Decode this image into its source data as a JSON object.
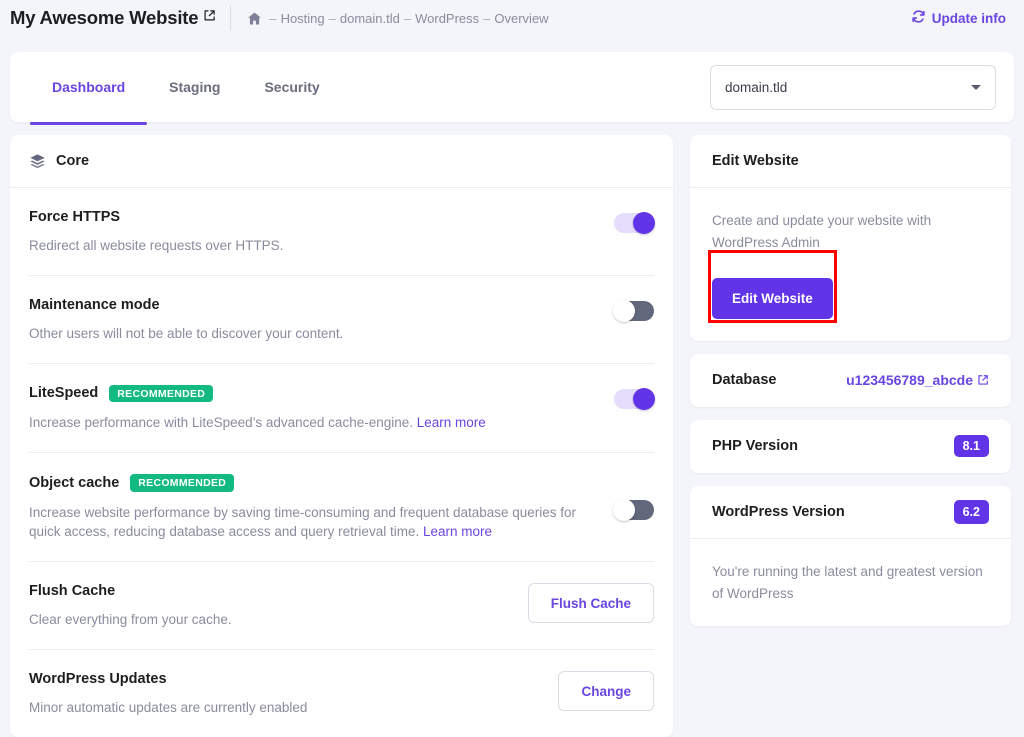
{
  "header": {
    "site_title": "My Awesome Website",
    "external_link_icon": "external-link-icon",
    "home_icon": "home-icon",
    "breadcrumb": [
      {
        "sep": "–",
        "label": "Hosting"
      },
      {
        "sep": "–",
        "label": "domain.tld"
      },
      {
        "sep": "–",
        "label": "WordPress"
      },
      {
        "sep": "–",
        "label": "Overview"
      }
    ],
    "update_info_label": "Update info",
    "update_info_icon": "refresh-icon",
    "accent_color": "#6945e2"
  },
  "tabbar": {
    "tabs": [
      {
        "label": "Dashboard",
        "active": true
      },
      {
        "label": "Staging",
        "active": false
      },
      {
        "label": "Security",
        "active": false
      }
    ],
    "domain_select": {
      "value": "domain.tld",
      "placeholder": "domain.tld",
      "caret_icon": "chevron-down-icon"
    }
  },
  "core_card": {
    "icon": "layers-stack-icon",
    "title": "Core",
    "rows": [
      {
        "title": "Force HTTPS",
        "desc": "Redirect all website requests over HTTPS.",
        "control": "toggle",
        "state": "on"
      },
      {
        "title": "Maintenance mode",
        "desc": "Other users will not be able to discover your content.",
        "control": "toggle",
        "state": "off"
      },
      {
        "title": "LiteSpeed",
        "badge": "RECOMMENDED",
        "desc": "Increase performance with LiteSpeed’s advanced cache-engine. ",
        "link": "Learn more",
        "control": "toggle",
        "state": "on"
      },
      {
        "title": "Object cache",
        "badge": "RECOMMENDED",
        "desc": "Increase website performance by saving time-consuming and frequent database queries for quick access, reducing database access and query retrieval time. ",
        "link": "Learn more",
        "control": "toggle",
        "state": "off"
      },
      {
        "title": "Flush Cache",
        "desc": "Clear everything from your cache.",
        "control": "button",
        "button_label": "Flush Cache"
      },
      {
        "title": "WordPress Updates",
        "desc": "Minor automatic updates are currently enabled",
        "control": "button",
        "button_label": "Change"
      }
    ],
    "badge_color": "#12b981"
  },
  "sidebar": {
    "edit_website": {
      "title": "Edit Website",
      "desc": "Create and update your website with WordPress Admin",
      "button_label": "Edit Website",
      "button_color": "#6134e8",
      "highlight_color": "#ff0000"
    },
    "database": {
      "label": "Database",
      "value": "u123456789_abcde",
      "icon": "external-link-icon"
    },
    "php_version": {
      "label": "PHP Version",
      "value": "8.1"
    },
    "wordpress_version": {
      "label": "WordPress Version",
      "value": "6.2",
      "desc": "You're running the latest and greatest version of WordPress"
    }
  }
}
